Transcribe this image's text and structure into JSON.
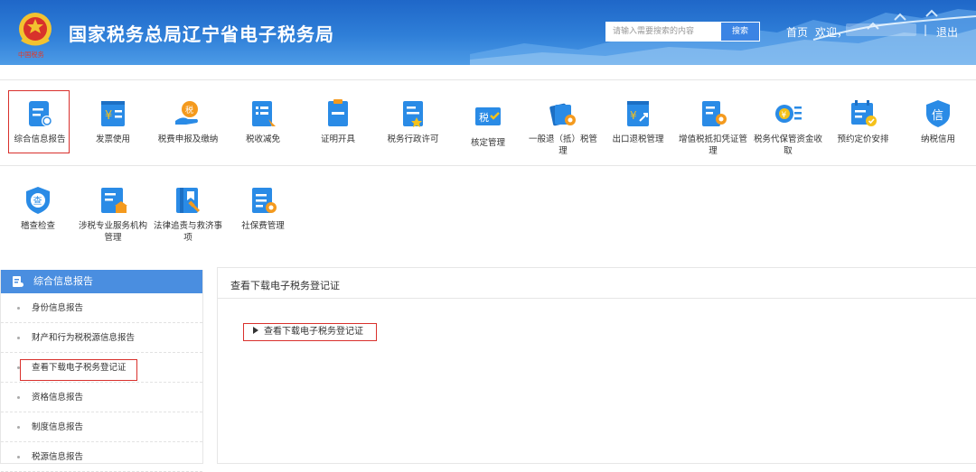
{
  "header": {
    "title": "国家税务总局辽宁省电子税务局",
    "seal_text": "中国税务",
    "search_placeholder": "请输入需要搜索的内容",
    "search_button": "搜索",
    "nav_home": "首页",
    "nav_welcome": "欢迎，",
    "nav_separator": "|",
    "nav_logout": "退出"
  },
  "menu_row1": [
    {
      "label": "综合信息报告",
      "icon": "report-icon"
    },
    {
      "label": "发票使用",
      "icon": "invoice-icon"
    },
    {
      "label": "税费申报及缴纳",
      "icon": "tax-payment-icon"
    },
    {
      "label": "税收减免",
      "icon": "tax-reduction-icon"
    },
    {
      "label": "证明开具",
      "icon": "certificate-icon"
    },
    {
      "label": "税务行政许可",
      "icon": "admin-permit-icon"
    },
    {
      "label": "核定管理",
      "icon": "assessment-icon"
    },
    {
      "label": "一般退（抵）税管理",
      "icon": "refund-icon"
    },
    {
      "label": "出口退税管理",
      "icon": "export-refund-icon"
    },
    {
      "label": "增值税抵扣凭证管理",
      "icon": "vat-deduction-icon"
    },
    {
      "label": "税务代保管资金收取",
      "icon": "custody-fund-icon"
    },
    {
      "label": "预约定价安排",
      "icon": "pricing-arrangement-icon"
    },
    {
      "label": "纳税信用",
      "icon": "tax-credit-icon"
    }
  ],
  "menu_row2": [
    {
      "label": "稽查检查",
      "icon": "inspection-icon"
    },
    {
      "label": "涉税专业服务机构管理",
      "icon": "agency-management-icon"
    },
    {
      "label": "法律追责与救济事项",
      "icon": "legal-relief-icon"
    },
    {
      "label": "社保费管理",
      "icon": "social-security-icon"
    }
  ],
  "sidebar": {
    "header": "综合信息报告",
    "items": [
      {
        "label": "身份信息报告"
      },
      {
        "label": "财产和行为税税源信息报告"
      },
      {
        "label": "查看下载电子税务登记证"
      },
      {
        "label": "资格信息报告"
      },
      {
        "label": "制度信息报告"
      },
      {
        "label": "税源信息报告"
      }
    ]
  },
  "main": {
    "title": "查看下载电子税务登记证",
    "link": "查看下载电子税务登记证"
  },
  "colors": {
    "header_blue": "#2f7fd8",
    "icon_blue": "#2a8be6",
    "icon_orange": "#f49a1e",
    "highlight_red": "#d9302c",
    "sidebar_head": "#4a8ee0"
  }
}
